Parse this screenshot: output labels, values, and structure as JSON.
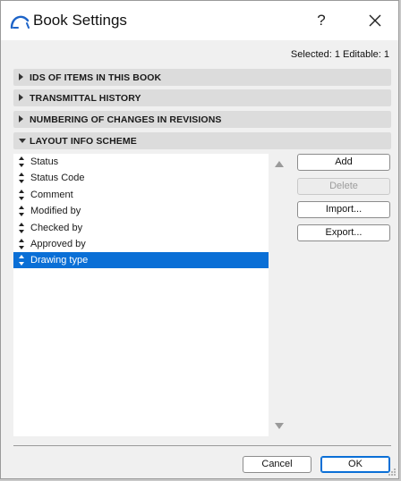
{
  "window": {
    "title": "Book Settings",
    "help_label": "?",
    "selection_info": "Selected: 1 Editable: 1"
  },
  "sections": [
    {
      "label": "IDS OF ITEMS IN THIS BOOK",
      "expanded": false
    },
    {
      "label": "TRANSMITTAL HISTORY",
      "expanded": false
    },
    {
      "label": "NUMBERING OF CHANGES IN REVISIONS",
      "expanded": false
    },
    {
      "label": "LAYOUT INFO SCHEME",
      "expanded": true
    }
  ],
  "scheme_list": {
    "items": [
      "Status",
      "Status Code",
      "Comment",
      "Modified by",
      "Checked by",
      "Approved by",
      "Drawing type"
    ],
    "selected": "Drawing type"
  },
  "side_buttons": {
    "add": "Add",
    "delete": "Delete",
    "import": "Import...",
    "export": "Export..."
  },
  "footer": {
    "cancel": "Cancel",
    "ok": "OK"
  },
  "colors": {
    "accent": "#0a6fd6",
    "section_bg": "#dcdcdc",
    "dialog_bg": "#f0f0f0"
  }
}
